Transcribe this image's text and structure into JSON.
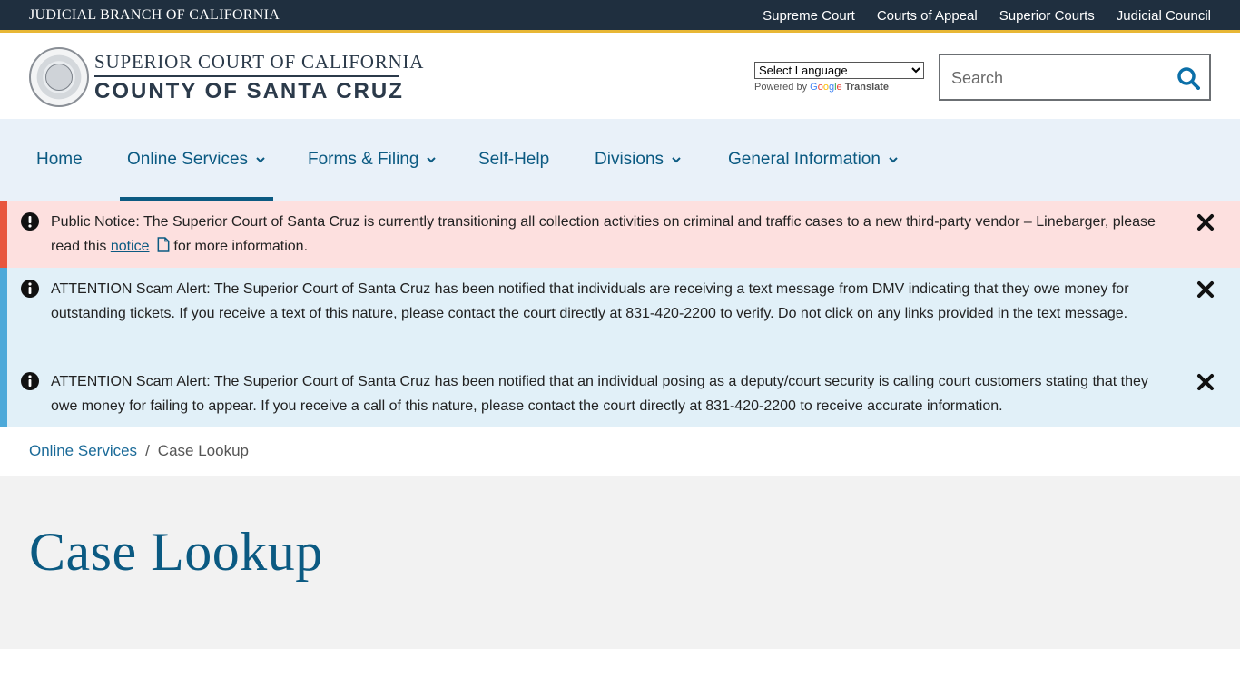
{
  "topbar": {
    "brand": "JUDICIAL BRANCH OF CALIFORNIA",
    "links": [
      "Supreme Court",
      "Courts of Appeal",
      "Superior Courts",
      "Judicial Council"
    ]
  },
  "header": {
    "line1": "SUPERIOR COURT OF CALIFORNIA",
    "line2": "COUNTY OF SANTA CRUZ",
    "seal_text": "JUDICIAL BRANCH OF CALIFORNIA",
    "language_select": "Select Language",
    "powered_by": "Powered by",
    "google": "Google",
    "translate": "Translate",
    "search_placeholder": "Search"
  },
  "nav": {
    "items": [
      {
        "label": "Home"
      },
      {
        "label": "Online Services"
      },
      {
        "label": "Forms & Filing"
      },
      {
        "label": "Self-Help"
      },
      {
        "label": "Divisions"
      },
      {
        "label": "General Information"
      }
    ],
    "active": "Online Services"
  },
  "alerts": [
    {
      "type": "notice",
      "text_before": "Public Notice: The Superior Court of Santa Cruz is currently transitioning all collection activities on criminal and traffic cases to a new third-party vendor – Linebarger, please read this ",
      "link": "notice",
      "text_after": " for more information."
    },
    {
      "type": "info",
      "text": "ATTENTION Scam Alert: The Superior Court of Santa Cruz has been notified that individuals are receiving a text message from DMV indicating that they owe money for outstanding tickets. If you receive a text of this nature, please contact the court directly at 831-420-2200 to verify. Do not click on any links provided in the text message."
    },
    {
      "type": "info",
      "text": "ATTENTION Scam Alert: The Superior Court of Santa Cruz has been notified that an individual posing as a deputy/court security is calling court customers stating that they owe money for failing to appear. If you receive a call of this nature, please contact the court directly at 831-420-2200 to receive accurate information."
    }
  ],
  "breadcrumb": {
    "parent": "Online Services",
    "separator": "/",
    "current": "Case Lookup"
  },
  "page": {
    "title": "Case Lookup"
  },
  "colors": {
    "topbar": "#1f2f3f",
    "accent_gold": "#e8b735",
    "nav_bg": "#e9f1f9",
    "link_blue": "#0b5a82",
    "notice_bg": "#fde0df",
    "notice_bar": "#e8563e",
    "info_bg": "#e1f0f8",
    "info_bar": "#4da9d9"
  }
}
